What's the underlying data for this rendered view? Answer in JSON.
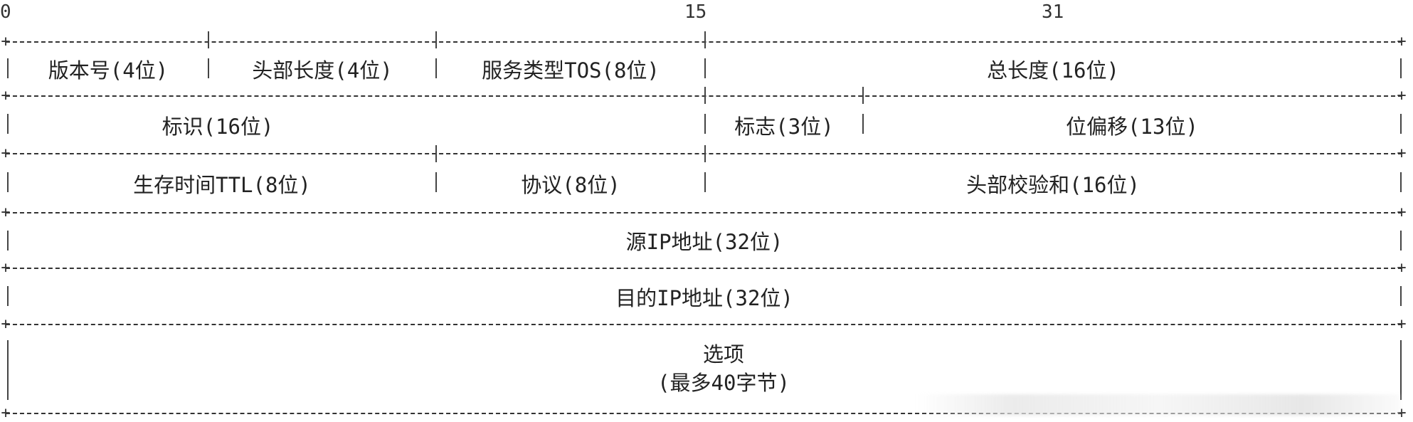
{
  "ruler": {
    "start": "0",
    "mid": "15",
    "end": "31"
  },
  "rows": {
    "row1": {
      "version": "版本号(4位)",
      "header_length": "头部长度(4位)",
      "tos": "服务类型TOS(8位)",
      "total_length": "总长度(16位)"
    },
    "row2": {
      "identification": "标识(16位)",
      "flags": "标志(3位)",
      "fragment_offset": "位偏移(13位)"
    },
    "row3": {
      "ttl": "生存时间TTL(8位)",
      "protocol": "协议(8位)",
      "checksum": "头部校验和(16位)"
    },
    "row4": {
      "source_ip": "源IP地址(32位)"
    },
    "row5": {
      "dest_ip": "目的IP地址(32位)"
    },
    "row6": {
      "options_line1": "选项",
      "options_line2": "(最多40字节)"
    }
  }
}
